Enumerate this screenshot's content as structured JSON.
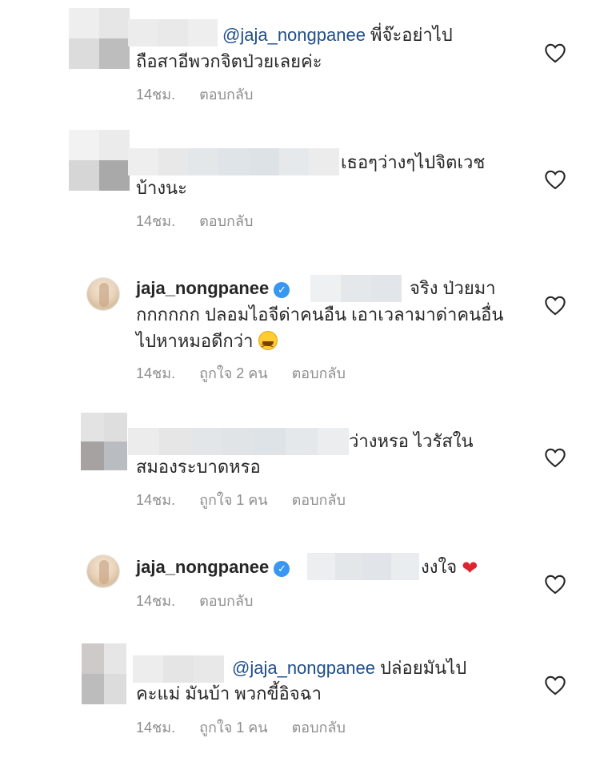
{
  "comments": [
    {
      "mention": "@jaja_nongpanee",
      "line1_rest": " พี่จ๊ะอย่าไป",
      "line2": "ถือสาอีพวกจิตป่วยเลยค่ะ",
      "time": "14ชม.",
      "reply": "ตอบกลับ"
    },
    {
      "line1_rest": "เธอๆว่างๆไปจิตเวช",
      "line2": "บ้างนะ",
      "time": "14ชม.",
      "reply": "ตอบกลับ"
    },
    {
      "username": "jaja_nongpanee",
      "line1_rest": "จริง ป่วยมา",
      "line2": "กกกกกก ปลอมไอจีด่าคนอืน เอาเวลามาด่าคนอื่น",
      "line3": "ไปหาหมอดีกว่า",
      "time": "14ชม.",
      "likes": "ถูกใจ 2 คน",
      "reply": "ตอบกลับ"
    },
    {
      "line1_rest": "ว่างหรอ ไวรัสใน",
      "line2": "สมองระบาดหรอ",
      "time": "14ชม.",
      "likes": "ถูกใจ 1 คน",
      "reply": "ตอบกลับ"
    },
    {
      "username": "jaja_nongpanee",
      "line1_rest": "งงใจ",
      "time": "14ชม.",
      "reply": "ตอบกลับ"
    },
    {
      "mention": "@jaja_nongpanee",
      "line1_rest": " ปล่อยมันไป",
      "line2": "คะแม่ มันบ้า พวกขี้อิจฉา",
      "time": "14ชม.",
      "likes": "ถูกใจ 1 คน",
      "reply": "ตอบกลับ"
    }
  ],
  "icons": {
    "like": "heart-outline-icon",
    "verified": "verified-badge-icon",
    "verified_glyph": "✓",
    "heart_emoji": "❤"
  },
  "colors": {
    "mention": "#1f4e8a",
    "meta": "#8e8e8e",
    "verified": "#3897f0"
  }
}
